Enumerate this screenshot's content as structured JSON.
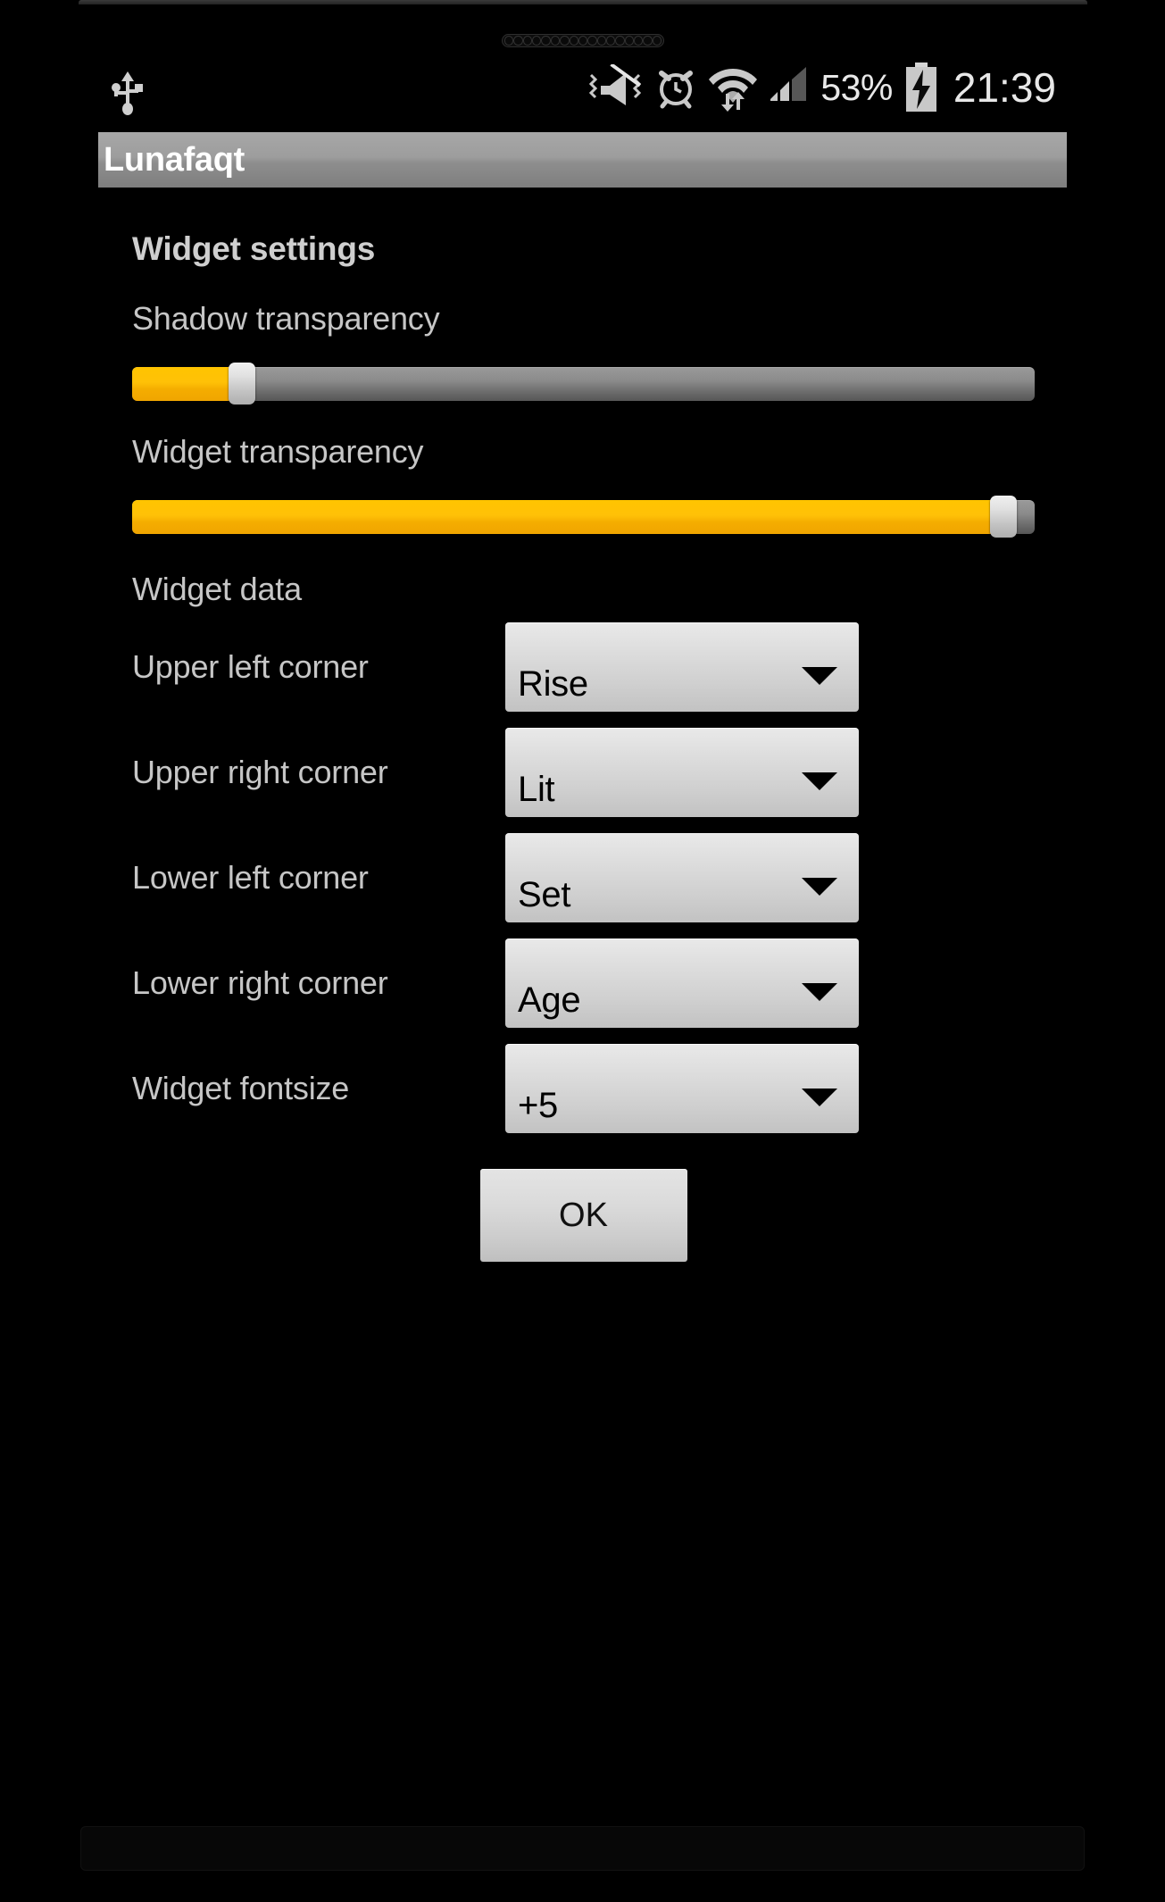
{
  "status_bar": {
    "usb_icon": "usb-icon",
    "silent_vibrate_icon": "silent-vibrate-icon",
    "alarm_icon": "alarm-clock-icon",
    "wifi_icon": "wifi-data-transfer-icon",
    "signal_icon": "cellular-signal-icon",
    "battery_percent": "53%",
    "battery_icon": "battery-charging-icon",
    "clock": "21:39"
  },
  "title_bar": {
    "app_title": "Lunafaqt"
  },
  "content": {
    "section_heading": "Widget settings",
    "shadow_transparency": {
      "label": "Shadow transparency",
      "value_percent": 11
    },
    "widget_transparency": {
      "label": "Widget transparency",
      "value_percent": 98
    },
    "widget_data_label": "Widget data",
    "spinners": [
      {
        "label": "Upper left corner",
        "value": "Rise",
        "arrow_icon": "chevron-down-icon"
      },
      {
        "label": "Upper right corner",
        "value": "Lit",
        "arrow_icon": "chevron-down-icon"
      },
      {
        "label": "Lower left corner",
        "value": "Set",
        "arrow_icon": "chevron-down-icon"
      },
      {
        "label": "Lower right corner",
        "value": "Age",
        "arrow_icon": "chevron-down-icon"
      },
      {
        "label": "Widget fontsize",
        "value": "+5",
        "arrow_icon": "chevron-down-icon"
      }
    ],
    "ok_button_label": "OK"
  },
  "colors": {
    "accent": "#ffc107",
    "track": "#8b8b8b",
    "title_bar": "#9d9d9d",
    "text": "#c6c6c6",
    "background": "#000000"
  }
}
